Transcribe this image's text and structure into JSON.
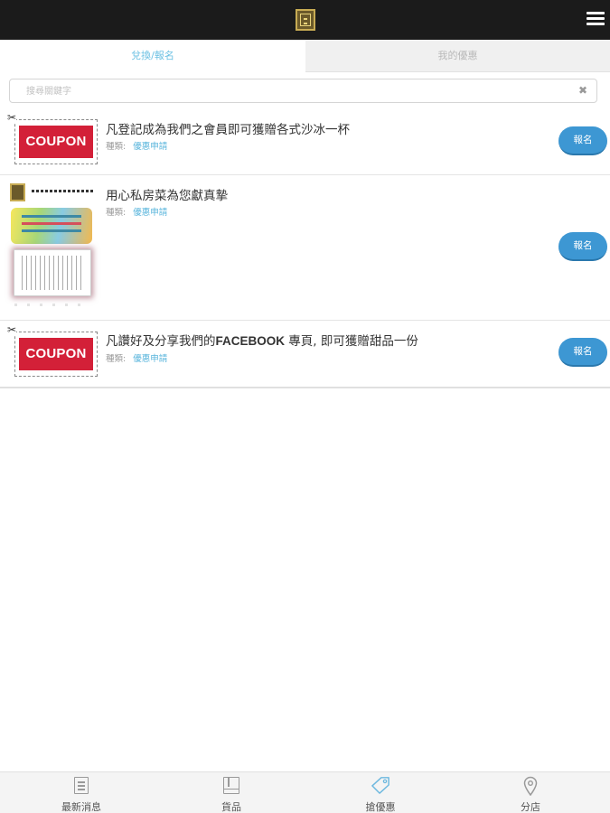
{
  "header": {
    "logo_icon": "restaurant-logo-icon",
    "menu_icon": "hamburger-menu-icon"
  },
  "tabs": [
    {
      "label": "兌換/報名",
      "active": true
    },
    {
      "label": "我的優惠",
      "active": false
    }
  ],
  "search": {
    "placeholder": "搜尋關鍵字",
    "clear_icon": "close-icon"
  },
  "coupons": [
    {
      "title": "凡登記成為我們之會員即可獲贈各式沙冰一杯",
      "category_label": "種類:",
      "category": "優惠申請",
      "button": "報名",
      "thumb_text": "COUPON"
    },
    {
      "title": "用心私房菜為您獻真摯",
      "category_label": "種類:",
      "category": "優惠申請",
      "button": "報名"
    },
    {
      "title_pre": "凡讚好及分享我們的",
      "title_bold": "FACEBOOK",
      "title_post": " 專頁, 即可獲贈甜品一份",
      "category_label": "種類:",
      "category": "優惠申請",
      "button": "報名",
      "thumb_text": "COUPON"
    }
  ],
  "bottom_nav": [
    {
      "label": "最新消息",
      "icon": "news-icon"
    },
    {
      "label": "貨品",
      "icon": "product-book-icon"
    },
    {
      "label": "搶優惠",
      "icon": "tag-icon",
      "active": true
    },
    {
      "label": "分店",
      "icon": "location-pin-icon"
    }
  ],
  "colors": {
    "header_bg": "#1b1b1b",
    "tab_active_text": "#6cc1e3",
    "button_bg": "#3d97d3",
    "coupon_red": "#d32038",
    "category_link": "#59b5dc"
  }
}
